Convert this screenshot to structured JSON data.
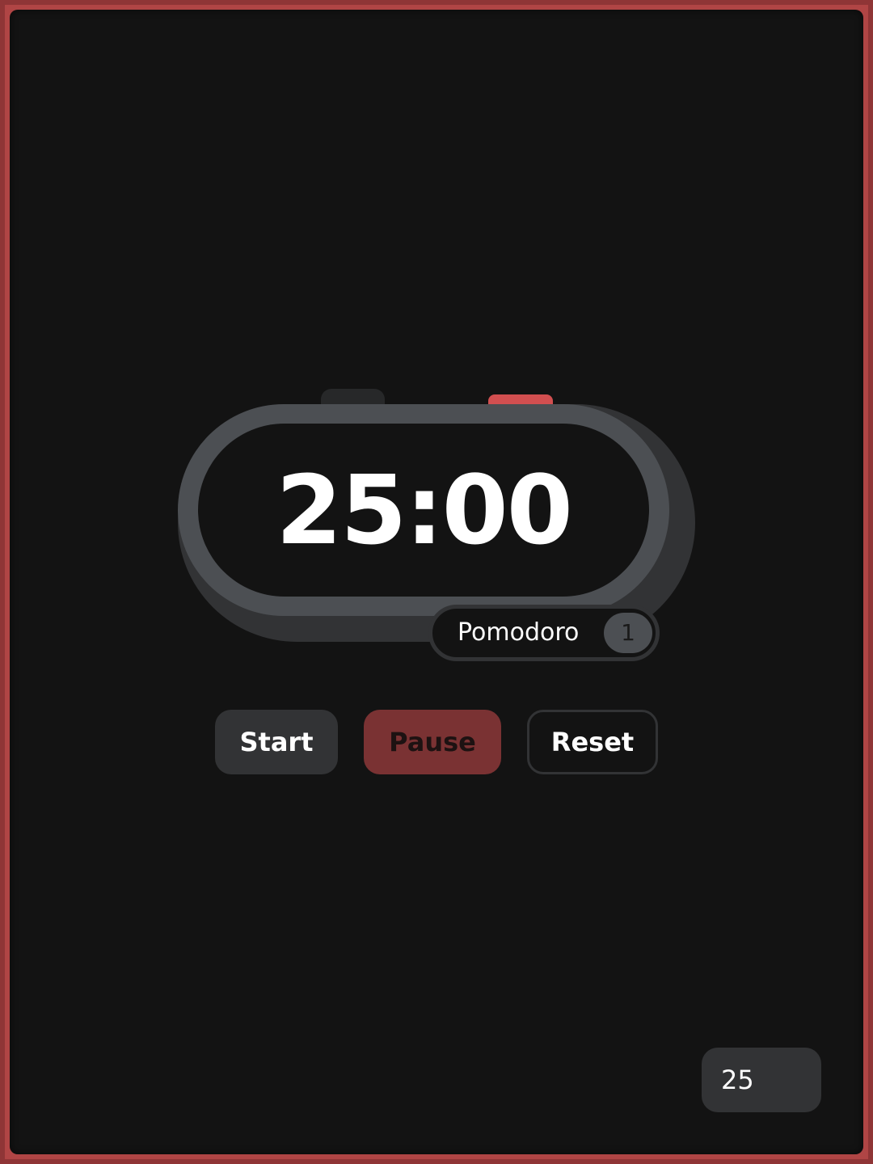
{
  "timer": {
    "time": "25:00",
    "mode": "Pomodoro",
    "session_count": "1"
  },
  "controls": {
    "start_label": "Start",
    "pause_label": "Pause",
    "reset_label": "Reset"
  },
  "settings": {
    "minutes_value": "25"
  },
  "colors": {
    "frame": "#b04545",
    "background": "#131313",
    "rim": "#4c4f53",
    "accent": "#d24f50",
    "pause_button": "#7a3233"
  },
  "icons": {
    "left_knob": "timer-knob-icon",
    "right_knob": "timer-button-icon"
  }
}
